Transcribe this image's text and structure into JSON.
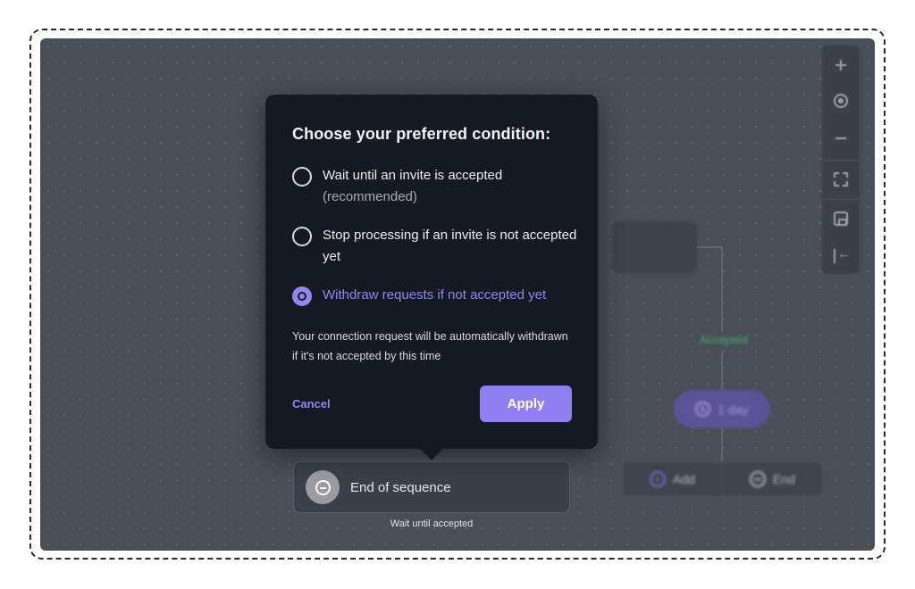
{
  "popup": {
    "title": "Choose your preferred condition:",
    "options": [
      {
        "label": "Wait until an invite is accepted",
        "sublabel": "(recommended)",
        "selected": false
      },
      {
        "label": "Stop processing if an invite is not accepted yet",
        "sublabel": "",
        "selected": false
      },
      {
        "label": "Withdraw requests if not accepted yet",
        "sublabel": "",
        "selected": true
      }
    ],
    "description": "Your connection request will be automatically withdrawn if it's not accepted by this time",
    "cancel_label": "Cancel",
    "apply_label": "Apply"
  },
  "flow": {
    "accepted_label": "Accepted",
    "delay_label": "1 day",
    "add_label": "Add",
    "end_label": "End",
    "end_node_label": "End of sequence",
    "end_node_sublabel": "Wait until accepted"
  },
  "toolbar": {
    "icons": [
      "plus-icon",
      "target-icon",
      "minus-icon",
      "fit-icon",
      "save-icon",
      "exit-icon"
    ]
  },
  "colors": {
    "accent": "#8f7ff0",
    "canvas": "#4a4e57",
    "popup_bg": "#151922",
    "accepted_green": "#45b06a"
  }
}
